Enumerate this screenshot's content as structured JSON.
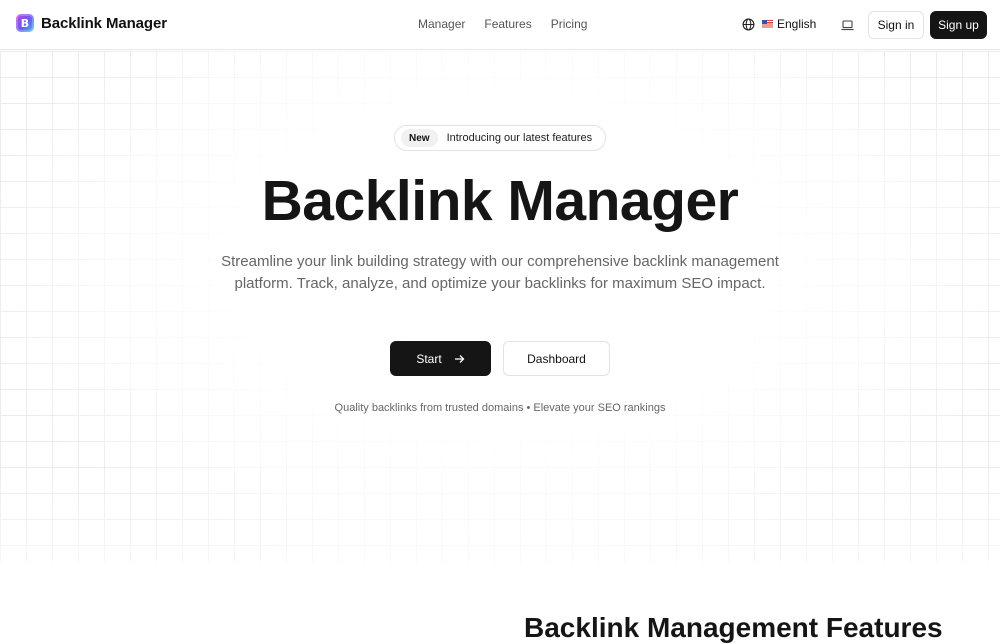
{
  "brand": {
    "name": "Backlink Manager",
    "logo_icon": "b-logo-icon",
    "logo_letter": "B"
  },
  "nav": {
    "items": [
      "Manager",
      "Features",
      "Pricing"
    ]
  },
  "header": {
    "language_label": "English",
    "language_icon": "globe-icon",
    "flag_icon": "us-flag-icon",
    "theme_icon": "laptop-icon",
    "signin_label": "Sign in",
    "signup_label": "Sign up"
  },
  "hero": {
    "badge_new": "New",
    "badge_text": "Introducing our latest features",
    "title": "Backlink Manager",
    "subtitle": "Streamline your link building strategy with our comprehensive backlink management platform. Track, analyze, and optimize your backlinks for maximum SEO impact.",
    "start_label": "Start",
    "start_icon": "arrow-right-icon",
    "dashboard_label": "Dashboard",
    "tagline": "Quality backlinks from trusted domains • Elevate your SEO rankings"
  },
  "features_section": {
    "title": "Backlink Management Features"
  },
  "colors": {
    "primary_button": "#151515",
    "text_muted": "#666666",
    "grid_line": "#ececec"
  }
}
